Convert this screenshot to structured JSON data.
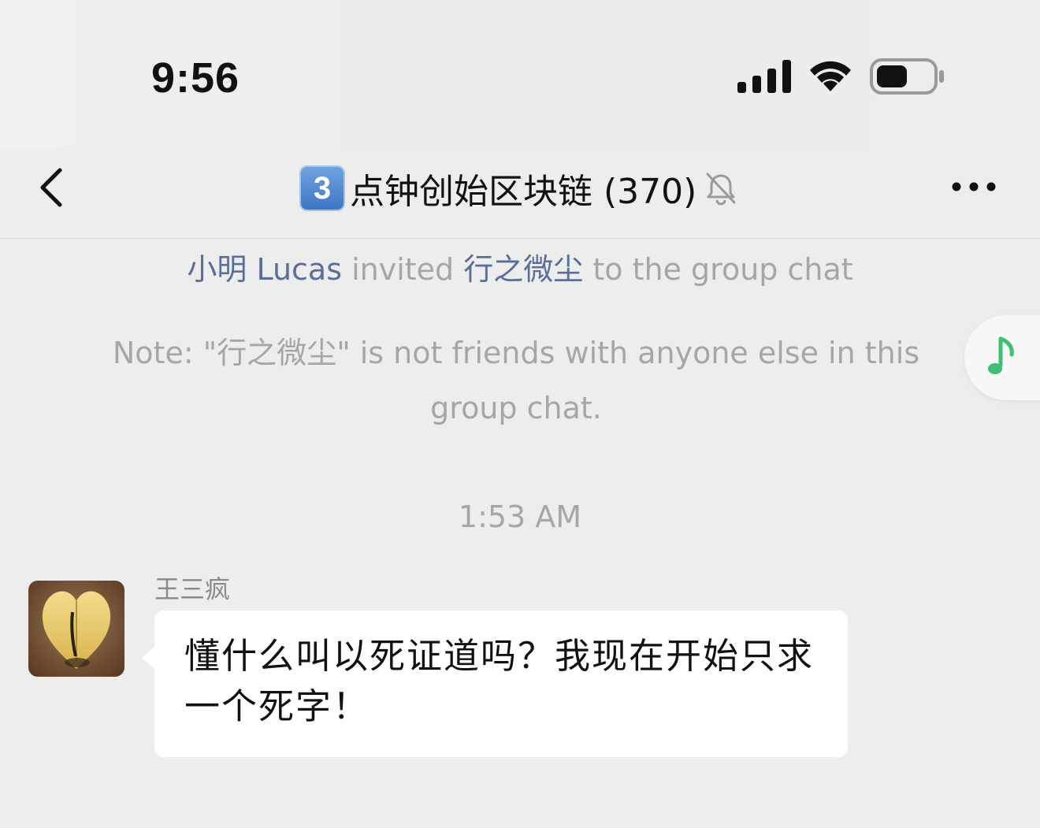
{
  "status_bar": {
    "time": "9:56",
    "signal_icon": "cellular-signal-icon",
    "wifi_icon": "wifi-icon",
    "battery_icon": "battery-icon"
  },
  "nav": {
    "back_icon": "chevron-left-icon",
    "badge": "3",
    "title": "点钟创始区块链 (370)",
    "mute_icon": "bell-slash-icon",
    "more_icon": "ellipsis-icon"
  },
  "messages": {
    "invite": {
      "inviter": "小明 Lucas",
      "action": " invited ",
      "invitee": "行之微尘",
      "suffix": " to the group chat"
    },
    "note": "Note: \"行之微尘\" is not friends with anyone else in this group chat.",
    "timestamp": "1:53 AM",
    "chat_message": {
      "sender": "王三疯",
      "text": "懂什么叫以死证道吗？我现在开始只求一个死字！"
    }
  },
  "floating": {
    "music_icon": "music-note-icon"
  },
  "colors": {
    "background": "#ededed",
    "link_name": "#5a6f98",
    "system_text": "#a6a6a6",
    "bubble": "#ffffff",
    "music_accent": "#3fbf73"
  }
}
